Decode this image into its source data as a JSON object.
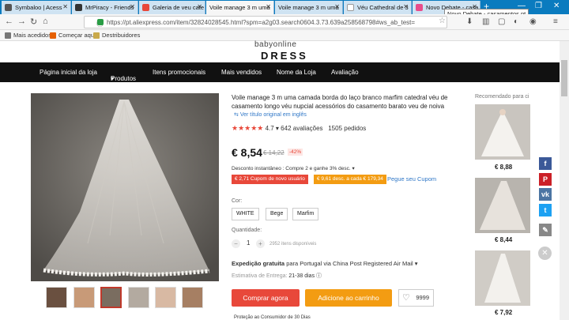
{
  "browser": {
    "tabs": [
      {
        "label": "Symbaloo | Acess"
      },
      {
        "label": "MrPiracy - Friends"
      },
      {
        "label": "Galeria de veu cate"
      },
      {
        "label": "Voile manage 3 m uma"
      },
      {
        "label": "Voile manage 3 m uma"
      },
      {
        "label": "Véu Cathedral de 3"
      },
      {
        "label": "Novo Debate - casa"
      }
    ],
    "tooltip": "Novo Debate - casamentos.pt",
    "url": "https://pt.aliexpress.com/item/32824028545.html?spm=a2g03.search0604.3.73.639a258568798#ws_ab_test=",
    "bookmarks": [
      {
        "label": "Mais acedidos"
      },
      {
        "label": "Começar aqui"
      },
      {
        "label": "Destribuidores"
      }
    ]
  },
  "store": {
    "logo_top": "babyonline",
    "logo_bottom": "DRESS",
    "nav": [
      "Página inicial da loja",
      "Produtos",
      "Itens promocionais",
      "Mais vendidos",
      "Nome da Loja",
      "Avaliação"
    ]
  },
  "product": {
    "title": "Voile manage 3 m uma camada borda do laço branco marfim catedral véu de casamento longo véu nupcial acessórios do casamento barato veu de noiva",
    "original_link": "Ver título original em inglês",
    "rating": "4.7",
    "reviews": "642 avaliações",
    "orders": "1505 pedidos",
    "price": "€ 8,54",
    "old_price": "€ 14,22",
    "discount": "-42%",
    "instant_discount": "Desconto instantâneo : Compre 2 e ganhe 3% desc.",
    "coupon_new_user": "€ 2,71 Cupom de novo usuário",
    "coupon_store": "€ 9,61 desc. a cada € 179,34",
    "follow": "Pegue seu Cupom",
    "color_label": "Cor:",
    "colors": [
      "WHITE",
      "Bege",
      "Marfim"
    ],
    "qty_label": "Quantidade:",
    "qty": "1",
    "available": "2952 itens disponíveis",
    "shipping_bold": "Expedição gratuita",
    "shipping_rest": "para Portugal via China Post Registered Air Mail",
    "delivery_label": "Estimativa de Entrega:",
    "delivery_value": "21-38 dias",
    "buy_now": "Comprar agora",
    "add_cart": "Adicione ao carrinho",
    "wishlist_count": "9999",
    "protection": "Proteção ao Consumidor de 30 Dias"
  },
  "recommended": {
    "title": "Recomendado para ci",
    "items": [
      {
        "price": "€ 8,88"
      },
      {
        "price": "€ 8,44"
      },
      {
        "price": "€ 7,92"
      }
    ]
  },
  "social": [
    {
      "icon": "facebook-icon",
      "glyph": "f",
      "color": "#3b5998"
    },
    {
      "icon": "pinterest-icon",
      "glyph": "P",
      "color": "#cb2027"
    },
    {
      "icon": "vk-icon",
      "glyph": "vk",
      "color": "#4c75a3"
    },
    {
      "icon": "twitter-icon",
      "glyph": "t",
      "color": "#1da1f2"
    },
    {
      "icon": "edit-icon",
      "glyph": "✎",
      "color": "#888888"
    }
  ]
}
